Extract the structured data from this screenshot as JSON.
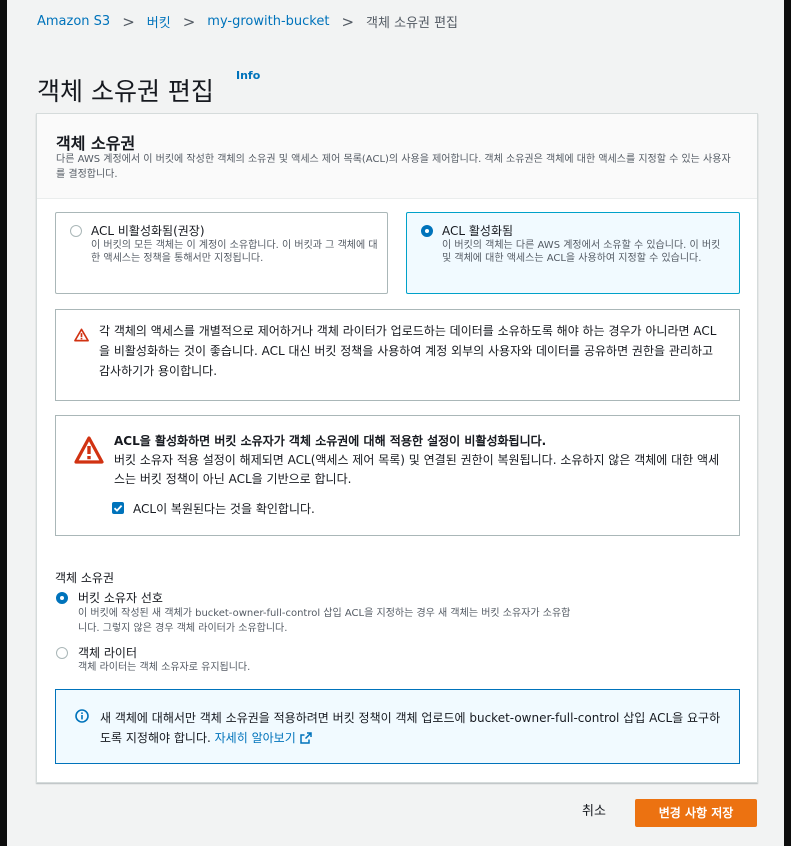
{
  "breadcrumb": {
    "items": [
      "Amazon S3",
      "버킷",
      "my-growith-bucket",
      "객체 소유권 편집"
    ],
    "separator": ">"
  },
  "page": {
    "title": "객체 소유권 편집",
    "info_link": "Info"
  },
  "panel": {
    "title": "객체 소유권",
    "description": "다른 AWS 계정에서 이 버킷에 작성한 객체의 소유권 및 액세스 제어 목록(ACL)의 사용을 제어합니다. 객체 소유권은 객체에 대한 액세스를 지정할 수 있는 사용자를 결정합니다."
  },
  "acl_tiles": [
    {
      "label": "ACL 비활성화됨(권장)",
      "description": "이 버킷의 모든 객체는 이 계정이 소유합니다. 이 버킷과 그 객체에 대한 액세스는 정책을 통해서만 지정됩니다.",
      "selected": false
    },
    {
      "label": "ACL 활성화됨",
      "description": "이 버킷의 객체는 다른 AWS 계정에서 소유할 수 있습니다. 이 버킷 및 객체에 대한 액세스는 ACL을 사용하여 지정할 수 있습니다.",
      "selected": true
    }
  ],
  "warning_recommend": {
    "text": "각 객체의 액세스를 개별적으로 제어하거나 객체 라이터가 업로드하는 데이터를 소유하도록 해야 하는 경우가 아니라면 ACL을 비활성화하는 것이 좋습니다. ACL 대신 버킷 정책을 사용하여 계정 외부의 사용자와 데이터를 공유하면 권한을 관리하고 감사하기가 용이합니다."
  },
  "warning_enable": {
    "title": "ACL을 활성화하면 버킷 소유자가 객체 소유권에 대해 적용한 설정이 비활성화됩니다.",
    "body": "버킷 소유자 적용 설정이 해제되면 ACL(액세스 제어 목록) 및 연결된 권한이 복원됩니다. 소유하지 않은 객체에 대한 액세스는 버킷 정책이 아닌 ACL을 기반으로 합니다.",
    "checkbox_label": "ACL이 복원된다는 것을 확인합니다.",
    "checkbox_checked": true
  },
  "ownership": {
    "label": "객체 소유권",
    "options": [
      {
        "label": "버킷 소유자 선호",
        "description": "이 버킷에 작성된 새 객체가 bucket-owner-full-control 삽입 ACL을 지정하는 경우 새 객체는 버킷 소유자가 소유합니다. 그렇지 않은 경우 객체 라이터가 소유합니다.",
        "selected": true
      },
      {
        "label": "객체 라이터",
        "description": "객체 라이터는 객체 소유자로 유지됩니다.",
        "selected": false
      }
    ]
  },
  "info_box": {
    "text": "새 객체에 대해서만 객체 소유권을 적용하려면 버킷 정책이 객체 업로드에 bucket-owner-full-control 삽입 ACL을 요구하도록 지정해야 합니다.",
    "link": "자세히 알아보기"
  },
  "footer": {
    "cancel": "취소",
    "save": "변경 사항 저장"
  },
  "colors": {
    "link": "#0073bb",
    "primary_button": "#ec7211",
    "warning_icon": "#d13212",
    "selected_tile_border": "#00a1c9"
  },
  "icons": [
    "chevron-right-icon",
    "warning-icon",
    "info-circle-icon",
    "external-link-icon",
    "checkmark-icon"
  ]
}
